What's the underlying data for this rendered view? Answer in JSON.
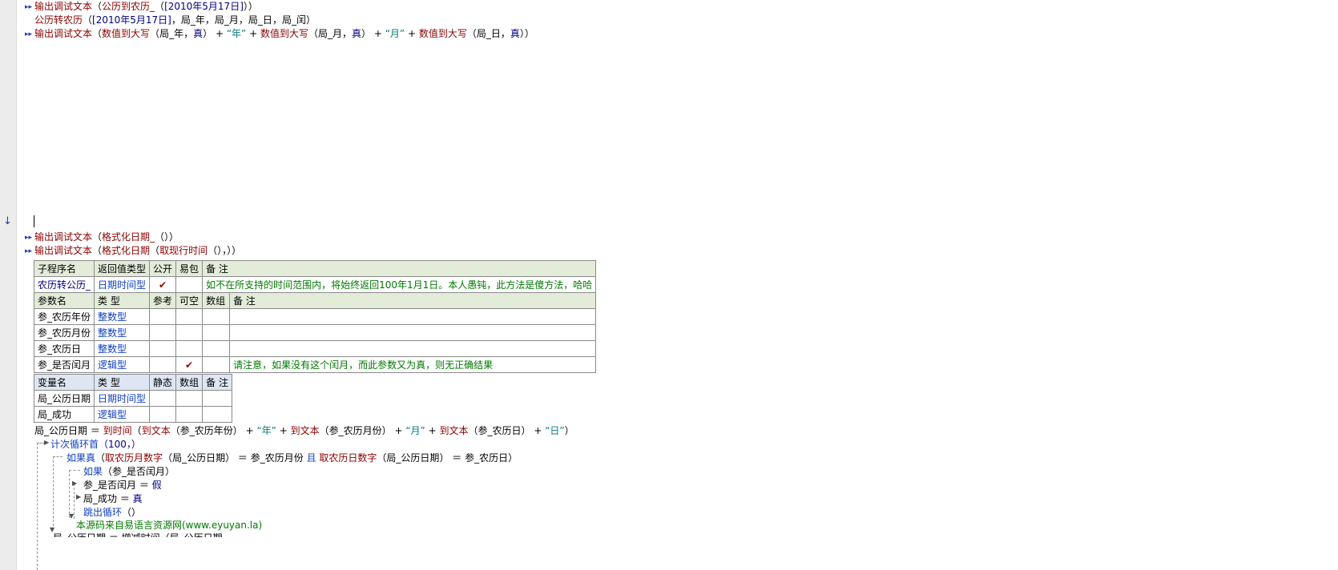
{
  "lines": {
    "l1": {
      "func": "输出调试文本",
      "open": "（",
      "inner": "公历到农历_",
      "inner_open": "（",
      "arg": "[2010年5月17日]",
      "close": "））"
    },
    "l2": {
      "func": "公历转农历",
      "open": "（",
      "arg1": "[2010年5月17日]",
      "sep1": "，",
      "arg2": "局_年",
      "sep2": "，",
      "arg3": "局_月",
      "sep3": "，",
      "arg4": "局_日",
      "sep4": "，",
      "arg5": "局_闰",
      "close": "）"
    },
    "l3": {
      "func": "输出调试文本",
      "open": "（",
      "f1": "数值到大写",
      "o1": "（",
      "a1": "局_年",
      "c1": "，",
      "a1b": "真",
      "e1": "）",
      "plus1": " + ",
      "s1": "“年”",
      "plus2": " + ",
      "f2": "数值到大写",
      "o2": "（",
      "a2": "局_月",
      "c2": "，",
      "a2b": "真",
      "e2": "）",
      "plus3": " + ",
      "s2": "“月”",
      "plus4": " + ",
      "f3": "数值到大写",
      "o3": "（",
      "a3": "局_日",
      "c3": "，",
      "a3b": "真",
      "e3": "））"
    },
    "l4": {
      "func": "输出调试文本",
      "open": "（",
      "inner": "格式化日期_",
      "close": "（））"
    },
    "l5": {
      "func": "输出调试文本",
      "open": "（",
      "inner": "格式化日期",
      "o2": "（",
      "inner2": "取现行时间",
      "close": "（），））"
    }
  },
  "sub_table": {
    "headers": [
      "子程序名",
      "返回值类型",
      "公开",
      "易包",
      "备 注"
    ],
    "row": {
      "name": "农历转公历_",
      "type": "日期时间型",
      "public": "✔",
      "pkg": "",
      "note": "如不在所支持的时间范围内，将始终返回100年1月1日。本人愚钝，此方法是傻方法，哈哈"
    },
    "param_headers": [
      "参数名",
      "类 型",
      "参考",
      "可空",
      "数组",
      "备 注"
    ],
    "params": [
      {
        "name": "参_农历年份",
        "type": "整数型",
        "ref": "",
        "nullable": "",
        "array": "",
        "note": ""
      },
      {
        "name": "参_农历月份",
        "type": "整数型",
        "ref": "",
        "nullable": "",
        "array": "",
        "note": ""
      },
      {
        "name": "参_农历日",
        "type": "整数型",
        "ref": "",
        "nullable": "",
        "array": "",
        "note": ""
      },
      {
        "name": "参_是否闰月",
        "type": "逻辑型",
        "ref": "",
        "nullable": "✔",
        "array": "",
        "note": "请注意，如果没有这个闰月，而此参数又为真，则无正确结果"
      }
    ]
  },
  "var_table": {
    "headers": [
      "变量名",
      "类 型",
      "静态",
      "数组",
      "备 注"
    ],
    "vars": [
      {
        "name": "局_公历日期",
        "type": "日期时间型"
      },
      {
        "name": "局_成功",
        "type": "逻辑型"
      }
    ]
  },
  "code": {
    "c1": {
      "lhs": "局_公历日期",
      "eq": " ＝ ",
      "f1": "到时间",
      "o1": "（",
      "f2": "到文本",
      "o2": "（",
      "a1": "参_农历年份",
      "e2": "）",
      "p1": " + ",
      "s1": "“年”",
      "p2": " + ",
      "f3": "到文本",
      "o3": "（",
      "a2": "参_农历月份",
      "e3": "）",
      "p3": " + ",
      "s2": "“月”",
      "p4": " + ",
      "f4": "到文本",
      "o4": "（",
      "a3": "参_农历日",
      "e4": "）",
      "p5": " + ",
      "s3": "“日”",
      "e1": "）"
    },
    "c2": {
      "kw": "计次循环首",
      "args": "（100，）"
    },
    "c3": {
      "kw": "如果真",
      "o": "（",
      "f1": "取农历月数字",
      "o1": "（",
      "a1": "局_公历日期",
      "e1": "）",
      "eq1": " ＝ ",
      "a2": "参_农历月份",
      "and": " 且 ",
      "f2": "取农历日数字",
      "o2": "（",
      "a3": "局_公历日期",
      "e2": "）",
      "eq2": " ＝ ",
      "a4": "参_农历日",
      "e": "）"
    },
    "c4": {
      "kw": "如果",
      "args": "（参_是否闰月）"
    },
    "c5": {
      "lhs": "参_是否闰月",
      "eq": " ＝ ",
      "val": "假"
    },
    "c6": {
      "lhs": "局_成功",
      "eq": " ＝ ",
      "val": "真"
    },
    "c7": {
      "kw": "跳出循环",
      "args": "（）"
    },
    "c8": {
      "comment": "本源码来自易语言资源网(www.eyuyan.la)"
    },
    "c9": {
      "partial": "局_公历日期 ＝ 增减时间（局_公历日期，"
    }
  }
}
